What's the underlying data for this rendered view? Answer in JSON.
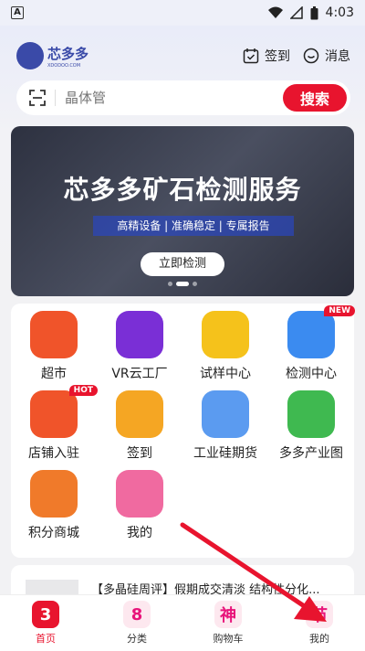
{
  "status": {
    "time": "4:03",
    "left_icon": "A"
  },
  "header": {
    "logo_text": "芯多多",
    "logo_sub": "XDODOO.COM",
    "checkin": "签到",
    "messages": "消息"
  },
  "search": {
    "placeholder": "晶体管",
    "button": "搜索"
  },
  "banner": {
    "title": "芯多多矿石检测服务",
    "subtitle": "高精设备 | 准确稳定 | 专属报告",
    "button": "立即检测"
  },
  "grid": [
    {
      "label": "超市",
      "icon": "supermarket-icon",
      "color": "#f0542a",
      "badge": ""
    },
    {
      "label": "VR云工厂",
      "icon": "vr-icon",
      "color": "#7a2fd6",
      "badge": ""
    },
    {
      "label": "试样中心",
      "icon": "sample-icon",
      "color": "#f5c21b",
      "badge": ""
    },
    {
      "label": "检测中心",
      "icon": "shield-check-icon",
      "color": "#3b8bf0",
      "badge": "NEW"
    },
    {
      "label": "店铺入驻",
      "icon": "store-icon",
      "color": "#f0542a",
      "badge": "HOT"
    },
    {
      "label": "签到",
      "icon": "calendar-icon",
      "color": "#f5a623",
      "badge": ""
    },
    {
      "label": "工业硅期货",
      "icon": "futures-icon",
      "color": "#5b9bf0",
      "badge": ""
    },
    {
      "label": "多多产业图",
      "icon": "map-pin-icon",
      "color": "#3fb950",
      "badge": ""
    },
    {
      "label": "积分商城",
      "icon": "coin-icon",
      "color": "#f07a2a",
      "badge": ""
    },
    {
      "label": "我的",
      "icon": "profile-icon",
      "color": "#f06aa0",
      "badge": ""
    }
  ],
  "news": {
    "title": "【多晶硅周评】假期成交清淡 结构性分化..."
  },
  "tabs": [
    {
      "label": "首页",
      "glyph": "3",
      "active": true
    },
    {
      "label": "分类",
      "glyph": "8",
      "active": false
    },
    {
      "label": "购物车",
      "glyph": "神",
      "active": false
    },
    {
      "label": "我的",
      "glyph": "节",
      "active": false
    }
  ]
}
